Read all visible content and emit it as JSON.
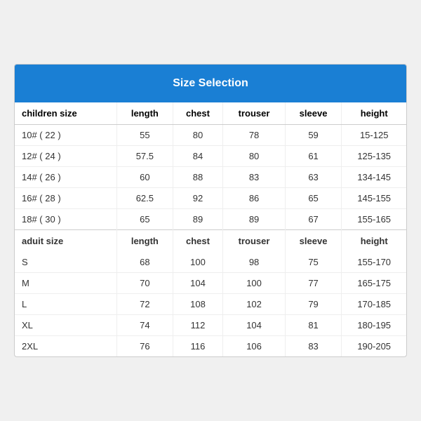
{
  "header": {
    "title": "Size Selection"
  },
  "children_section": {
    "label": "children size",
    "columns": [
      "length",
      "chest",
      "trouser",
      "sleeve",
      "height"
    ],
    "rows": [
      {
        "size": "10# ( 22 )",
        "length": "55",
        "chest": "80",
        "trouser": "78",
        "sleeve": "59",
        "height": "15-125"
      },
      {
        "size": "12# ( 24 )",
        "length": "57.5",
        "chest": "84",
        "trouser": "80",
        "sleeve": "61",
        "height": "125-135"
      },
      {
        "size": "14# ( 26 )",
        "length": "60",
        "chest": "88",
        "trouser": "83",
        "sleeve": "63",
        "height": "134-145"
      },
      {
        "size": "16# ( 28 )",
        "length": "62.5",
        "chest": "92",
        "trouser": "86",
        "sleeve": "65",
        "height": "145-155"
      },
      {
        "size": "18# ( 30 )",
        "length": "65",
        "chest": "89",
        "trouser": "89",
        "sleeve": "67",
        "height": "155-165"
      }
    ]
  },
  "adult_section": {
    "label": "aduit size",
    "columns": [
      "length",
      "chest",
      "trouser",
      "sleeve",
      "height"
    ],
    "rows": [
      {
        "size": "S",
        "length": "68",
        "chest": "100",
        "trouser": "98",
        "sleeve": "75",
        "height": "155-170"
      },
      {
        "size": "M",
        "length": "70",
        "chest": "104",
        "trouser": "100",
        "sleeve": "77",
        "height": "165-175"
      },
      {
        "size": "L",
        "length": "72",
        "chest": "108",
        "trouser": "102",
        "sleeve": "79",
        "height": "170-185"
      },
      {
        "size": "XL",
        "length": "74",
        "chest": "112",
        "trouser": "104",
        "sleeve": "81",
        "height": "180-195"
      },
      {
        "size": "2XL",
        "length": "76",
        "chest": "116",
        "trouser": "106",
        "sleeve": "83",
        "height": "190-205"
      }
    ]
  }
}
